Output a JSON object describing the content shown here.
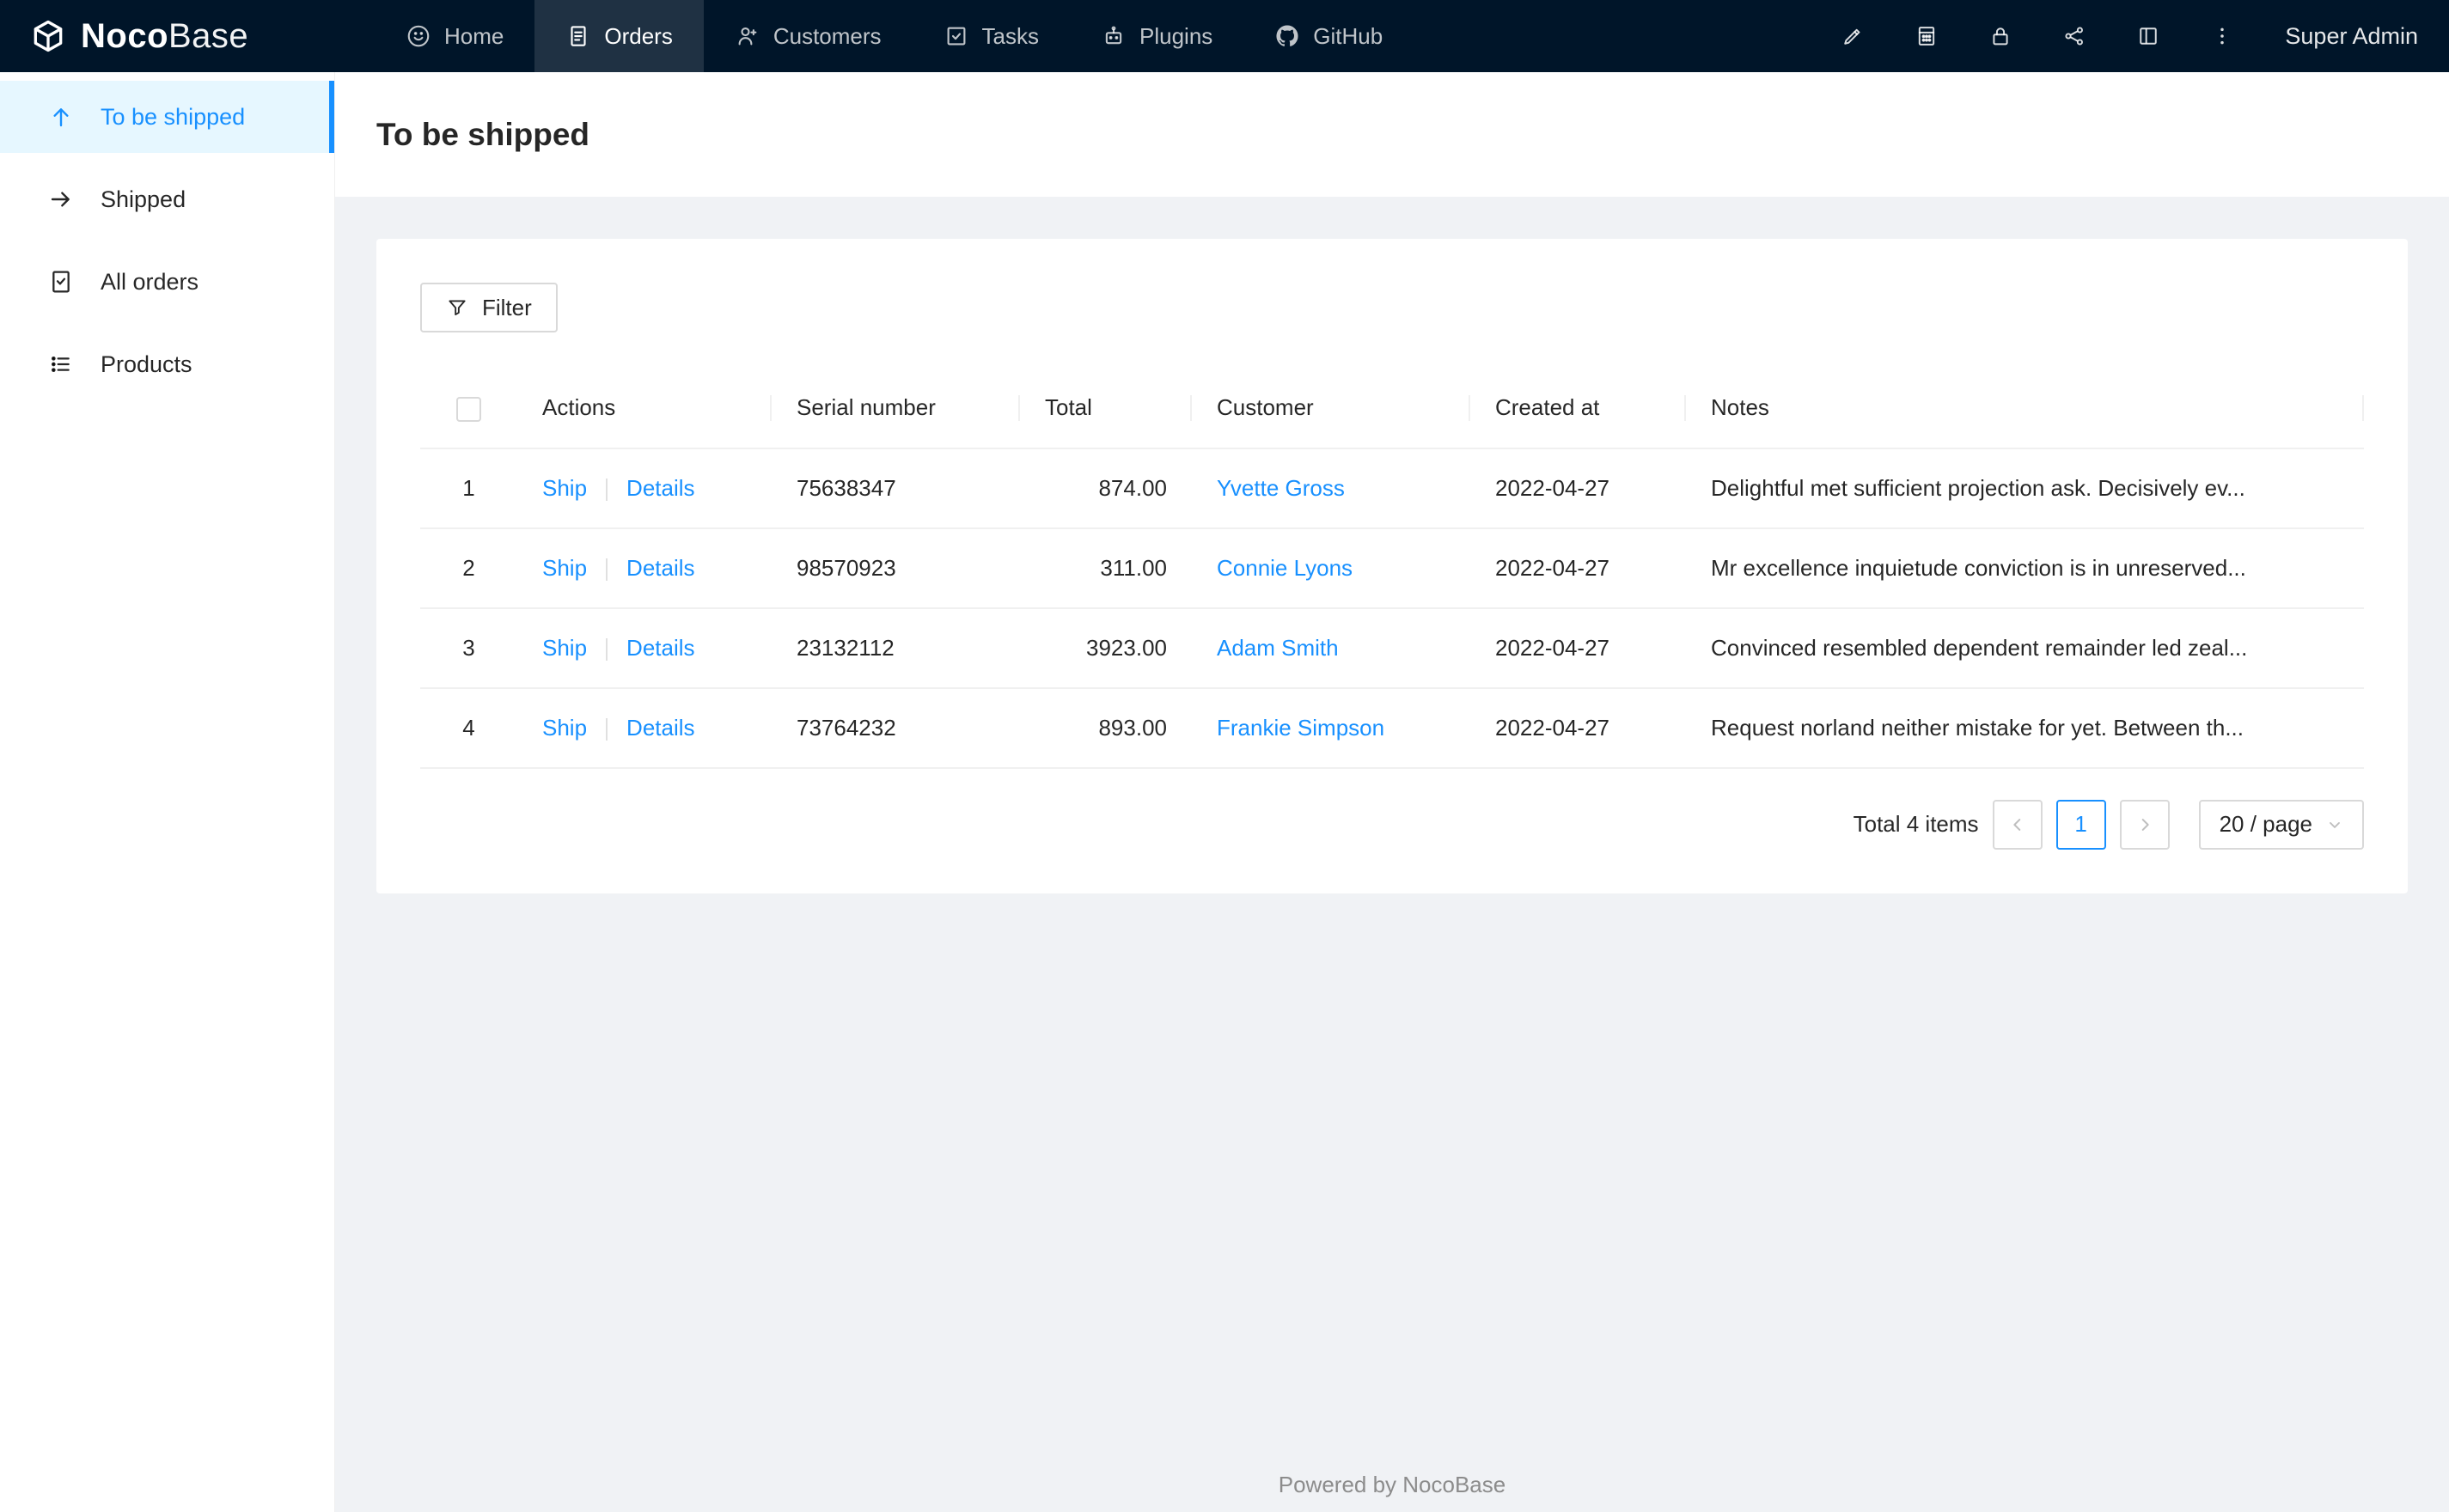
{
  "navbar": {
    "logo_noco": "Noco",
    "logo_base": "Base",
    "items": [
      {
        "label": "Home"
      },
      {
        "label": "Orders"
      },
      {
        "label": "Customers"
      },
      {
        "label": "Tasks"
      },
      {
        "label": "Plugins"
      },
      {
        "label": "GitHub"
      }
    ],
    "user": "Super Admin"
  },
  "sidebar": {
    "items": [
      {
        "label": "To be shipped"
      },
      {
        "label": "Shipped"
      },
      {
        "label": "All orders"
      },
      {
        "label": "Products"
      }
    ]
  },
  "page": {
    "title": "To be shipped"
  },
  "toolbar": {
    "filter": "Filter"
  },
  "table": {
    "columns": {
      "actions": "Actions",
      "serial": "Serial number",
      "total": "Total",
      "customer": "Customer",
      "created": "Created at",
      "notes": "Notes"
    },
    "rows": [
      {
        "index": "1",
        "ship": "Ship",
        "details": "Details",
        "serial": "75638347",
        "total": "874.00",
        "customer": "Yvette Gross",
        "created": "2022-04-27",
        "notes": "Delightful met sufficient projection ask. Decisively ev..."
      },
      {
        "index": "2",
        "ship": "Ship",
        "details": "Details",
        "serial": "98570923",
        "total": "311.00",
        "customer": "Connie Lyons",
        "created": "2022-04-27",
        "notes": "Mr excellence inquietude conviction is in unreserved..."
      },
      {
        "index": "3",
        "ship": "Ship",
        "details": "Details",
        "serial": "23132112",
        "total": "3923.00",
        "customer": "Adam Smith",
        "created": "2022-04-27",
        "notes": "Convinced resembled dependent remainder led zeal..."
      },
      {
        "index": "4",
        "ship": "Ship",
        "details": "Details",
        "serial": "73764232",
        "total": "893.00",
        "customer": "Frankie Simpson",
        "created": "2022-04-27",
        "notes": "Request norland neither mistake for yet. Between th..."
      }
    ]
  },
  "pagination": {
    "total": "Total 4 items",
    "page": "1",
    "size": "20 / page"
  },
  "footer": {
    "text": "Powered by NocoBase"
  },
  "colors": {
    "accent": "#1890ff",
    "navbar_bg": "#001529",
    "sidebar_selected_bg": "#e6f7ff",
    "content_bg": "#f0f2f5",
    "border": "#d9d9d9"
  },
  "icons": {
    "nocobase-logo-icon": "white isometric cube",
    "home-icon": "smile circle",
    "orders-icon": "receipt document",
    "customers-icon": "person with plus",
    "tasks-icon": "checkbox with check",
    "plugins-icon": "robot head",
    "github-icon": "github mark",
    "highlighter-icon": "pen",
    "calculator-icon": "calculator",
    "lock-icon": "padlock",
    "share-icon": "connected nodes",
    "layout-icon": "split rectangle",
    "more-icon": "vertical ellipsis",
    "arrow-up-icon": "up arrow",
    "arrow-right-icon": "right arrow",
    "all-orders-icon": "document with check",
    "products-icon": "bulleted list",
    "filter-icon": "funnel",
    "chevron-left-icon": "previous page",
    "chevron-right-icon": "next page",
    "chevron-down-icon": "select caret"
  }
}
